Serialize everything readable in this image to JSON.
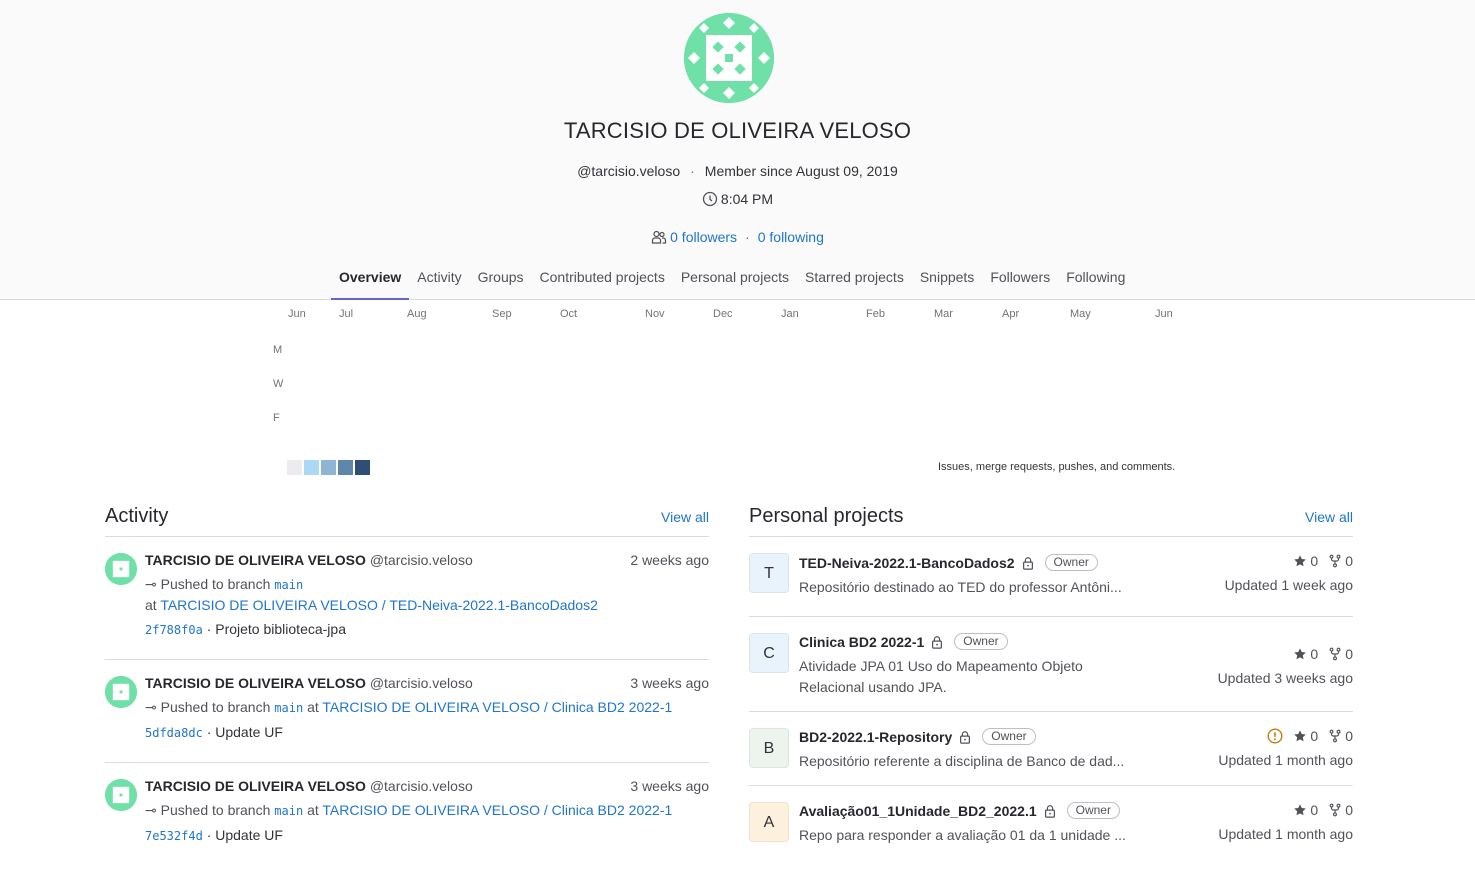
{
  "profile": {
    "name": "TARCISIO DE OLIVEIRA VELOSO",
    "username": "@tarcisio.veloso",
    "member_since": "Member since August 09, 2019",
    "local_time": "8:04 PM",
    "followers": "0 followers",
    "following": "0 following"
  },
  "tabs": [
    "Overview",
    "Activity",
    "Groups",
    "Contributed projects",
    "Personal projects",
    "Starred projects",
    "Snippets",
    "Followers",
    "Following"
  ],
  "calendar": {
    "months": [
      "Jun",
      "Jul",
      "Aug",
      "Sep",
      "Oct",
      "Nov",
      "Dec",
      "Jan",
      "Feb",
      "Mar",
      "Apr",
      "May",
      "Jun"
    ],
    "day_labels": [
      "M",
      "W",
      "F"
    ],
    "note": "Issues, merge requests, pushes, and comments.",
    "colors": [
      "#ececef",
      "#aad8f5",
      "#8fb5d4",
      "#5f87ab",
      "#2e4e74"
    ]
  },
  "activity": {
    "title": "Activity",
    "view_all": "View all",
    "items": [
      {
        "name": "TARCISIO DE OLIVEIRA VELOSO",
        "user": "@tarcisio.veloso",
        "time": "2 weeks ago",
        "action": "Pushed to branch",
        "branch": "main",
        "at": "at",
        "project": "TARCISIO DE OLIVEIRA VELOSO / TED-Neiva-2022.1-BancoDados2",
        "sha": "2f788f0a",
        "message": "· Projeto biblioteca-jpa"
      },
      {
        "name": "TARCISIO DE OLIVEIRA VELOSO",
        "user": "@tarcisio.veloso",
        "time": "3 weeks ago",
        "action": "Pushed to branch",
        "branch": "main",
        "at": "at",
        "project": "TARCISIO DE OLIVEIRA VELOSO / Clinica BD2 2022-1",
        "sha": "5dfda8dc",
        "message": "· Update UF"
      },
      {
        "name": "TARCISIO DE OLIVEIRA VELOSO",
        "user": "@tarcisio.veloso",
        "time": "3 weeks ago",
        "action": "Pushed to branch",
        "branch": "main",
        "at": "at",
        "project": "TARCISIO DE OLIVEIRA VELOSO / Clinica BD2 2022-1",
        "sha": "7e532f4d",
        "message": "· Update UF"
      }
    ]
  },
  "projects": {
    "title": "Personal projects",
    "view_all": "View all",
    "items": [
      {
        "letter": "T",
        "color": "#e8f3fc",
        "name": "TED-Neiva-2022.1-BancoDados2",
        "role": "Owner",
        "desc": "Repositório destinado ao TED do professor Antôni...",
        "stars": "0",
        "forks": "0",
        "updated": "Updated 1 week ago"
      },
      {
        "letter": "C",
        "color": "#e8f3fc",
        "name": "Clinica BD2 2022-1",
        "role": "Owner",
        "desc": "Atividade JPA 01 Uso do Mapeamento Objeto Relacional usando JPA.",
        "stars": "0",
        "forks": "0",
        "updated": "Updated 3 weeks ago"
      },
      {
        "letter": "B",
        "color": "#ecf4ee",
        "name": "BD2-2022.1-Repository",
        "role": "Owner",
        "desc": "Repositório referente a disciplina de Banco de dad...",
        "stars": "0",
        "forks": "0",
        "updated": "Updated 1 month ago",
        "warning": true
      },
      {
        "letter": "A",
        "color": "#fdf1dd",
        "name": "Avaliação01_1Unidade_BD2_2022.1",
        "role": "Owner",
        "desc": "Repo para responder a avaliação 01 da 1 unidade ...",
        "stars": "0",
        "forks": "0",
        "updated": "Updated 1 month ago"
      }
    ]
  }
}
